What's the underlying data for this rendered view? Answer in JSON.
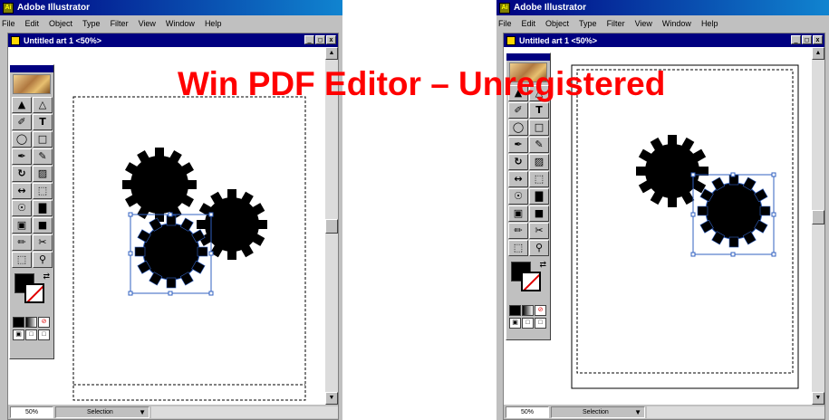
{
  "watermark": "Win PDF Editor – Unregistered",
  "windows": [
    {
      "app_title": "Adobe Illustrator",
      "menu": [
        "File",
        "Edit",
        "Object",
        "Type",
        "Filter",
        "View",
        "Window",
        "Help"
      ],
      "doc_title": "Untitled art 1 <50%>",
      "window_buttons": [
        "_",
        "□",
        "x"
      ],
      "status": {
        "zoom": "50%",
        "mode": "Selection"
      },
      "tools": [
        "▲",
        "△",
        "✐",
        "T",
        "◯",
        "□",
        "✒",
        "✎",
        "↻",
        "▨",
        "↔",
        "⬚",
        "☉",
        "▇",
        "▣",
        "■",
        "✏",
        "✂",
        "⬚",
        "⚲"
      ]
    },
    {
      "app_title": "Adobe Illustrator",
      "menu": [
        "File",
        "Edit",
        "Object",
        "Type",
        "Filter",
        "View",
        "Window",
        "Help"
      ],
      "doc_title": "Untitled art 1 <50%>",
      "window_buttons": [
        "_",
        "□",
        "x"
      ],
      "status": {
        "zoom": "50%",
        "mode": "Selection"
      },
      "tools": [
        "▲",
        "△",
        "✐",
        "T",
        "◯",
        "□",
        "✒",
        "✎",
        "↻",
        "▨",
        "↔",
        "⬚",
        "☉",
        "▇",
        "▣",
        "■",
        "✏",
        "✂",
        "⬚",
        "⚲"
      ]
    }
  ],
  "colors": {
    "titlebar": "#000080",
    "watermark": "#ff0000",
    "selection": "#3060c0",
    "stroke_none": "#e00000"
  }
}
